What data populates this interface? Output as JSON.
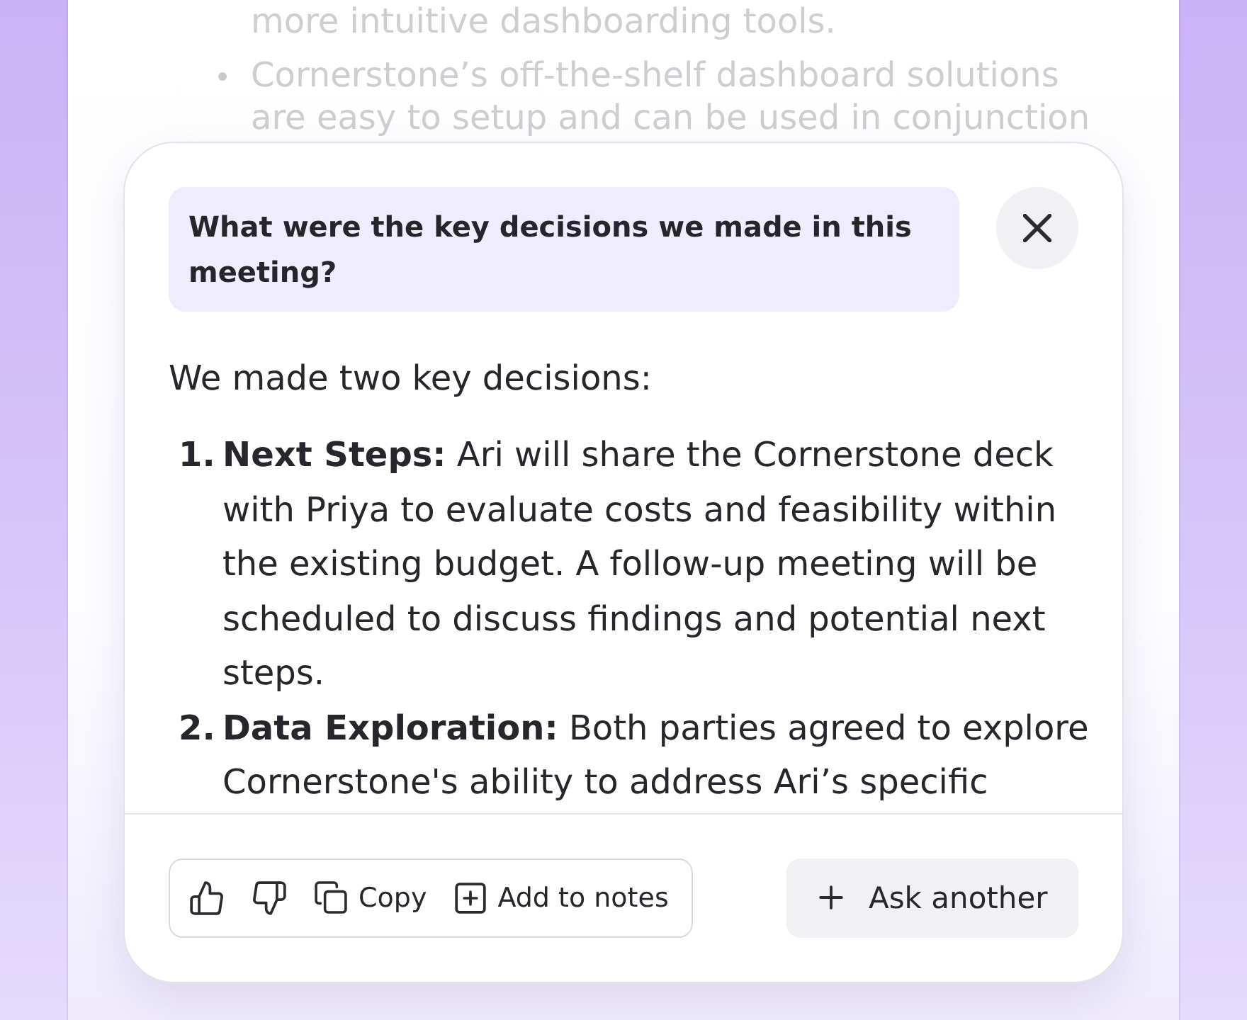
{
  "background_document": {
    "items": [
      {
        "bullet_visible": false,
        "text": "more intuitive dashboarding tools."
      },
      {
        "bullet_visible": true,
        "text": "Cornerstone’s off-the-shelf dashboard solutions are easy to setup and can be used in conjunction"
      }
    ]
  },
  "assistant_panel": {
    "question": "What were the key decisions we made in this meeting?",
    "answer": {
      "intro": "We made two key decisions:",
      "items": [
        {
          "number": "1.",
          "text": "**Next Steps:** Ari will share the Cornerstone deck with Priya to evaluate costs and feasibility within the existing budget. A follow-up meeting will be scheduled to discuss findings and potential next steps."
        },
        {
          "number": "2.",
          "text": "**Data Exploration:** Both parties agreed to explore Cornerstone's ability to address Ari’s specific"
        }
      ]
    },
    "actions": [
      {
        "kind": "like"
      },
      {
        "kind": "dislike"
      },
      {
        "kind": "copy",
        "label": "Copy"
      },
      {
        "kind": "add_note",
        "label": "Add to notes"
      }
    ],
    "ask_button": {
      "label": "Ask another"
    }
  }
}
